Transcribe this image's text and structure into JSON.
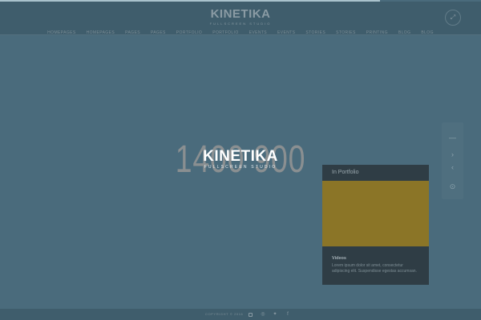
{
  "progress": {
    "value_percent": 79,
    "color": "#a9c2cc"
  },
  "header": {
    "logo_text": "KINETIKA",
    "logo_tagline": "FULLSCREEN STUDIO",
    "fullscreen_icon": "expand-icon"
  },
  "nav": {
    "items": [
      "HOMEPAGES",
      "HOMEPAGES",
      "PAGES",
      "PAGES",
      "PORTFOLIO",
      "PORTFOLIO",
      "EVENTS",
      "EVENTS",
      "STORIES",
      "STORIES",
      "PRINTING",
      "BLOG",
      "BLOG"
    ]
  },
  "hero": {
    "background_text": "1400 900",
    "logo_text": "KINETIKA",
    "logo_tagline": "FULLSCREEN STUDIO"
  },
  "side_nav": {
    "icons": [
      "dash-icon",
      "chevron-right-icon",
      "chevron-left-icon",
      "pin-icon"
    ],
    "glyphs": [
      "—",
      "›",
      "‹",
      "⊙"
    ]
  },
  "popup": {
    "header": "In Portfolio",
    "media_color": "#8b7527",
    "title": "Videos",
    "description": "Lorem ipsum dolor sit amet, consectetur adipiscing elit. Suspendisse egestas accumsan."
  },
  "footer": {
    "copyright": "COPYRIGHT © 2016",
    "social_icons": [
      "video-icon",
      "instagram-icon",
      "twitter-icon",
      "facebook-icon"
    ],
    "social_glyphs": [
      "",
      "◎",
      "✦",
      "f"
    ]
  },
  "colors": {
    "background": "#4a6b7c",
    "bar": "#3f5d6c",
    "popup_bg": "#2f3d45"
  }
}
